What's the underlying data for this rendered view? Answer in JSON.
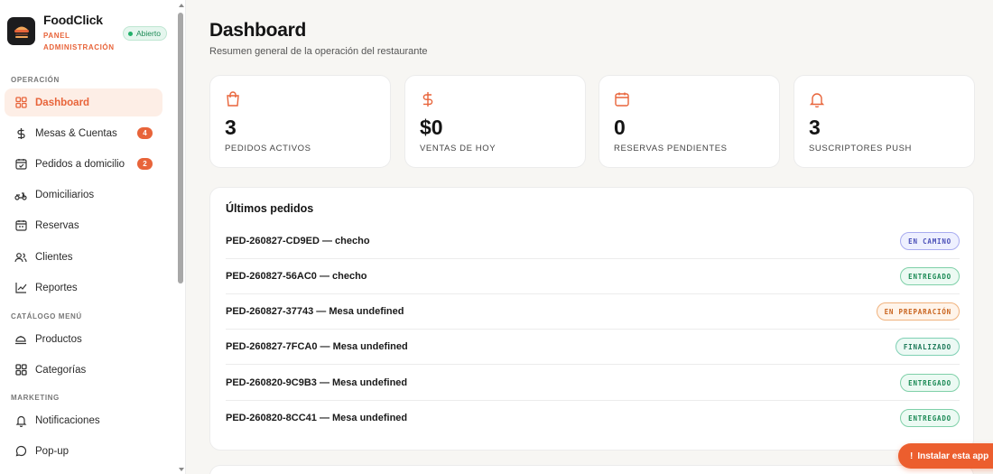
{
  "brand": {
    "name": "FoodClick",
    "subtitle_line1": "PANEL",
    "subtitle_line2": "ADMINISTRACIÓN",
    "status": "Abierto"
  },
  "sidebar": {
    "sections": {
      "operacion": "OPERACIÓN",
      "catalogo": "CATÁLOGO MENÚ",
      "marketing": "MARKETING"
    },
    "items": [
      {
        "label": "Dashboard",
        "icon": "grid-icon",
        "active": true
      },
      {
        "label": "Mesas & Cuentas",
        "icon": "dollar-icon",
        "badge": "4"
      },
      {
        "label": "Pedidos a domicilio",
        "icon": "calendar-check-icon",
        "badge": "2"
      },
      {
        "label": "Domiciliarios",
        "icon": "scooter-icon"
      },
      {
        "label": "Reservas",
        "icon": "calendar-icon"
      },
      {
        "label": "Clientes",
        "icon": "users-icon"
      },
      {
        "label": "Reportes",
        "icon": "chart-line-icon"
      },
      {
        "label": "Productos",
        "icon": "dish-icon"
      },
      {
        "label": "Categorías",
        "icon": "grid-icon"
      },
      {
        "label": "Notificaciones",
        "icon": "bell-icon"
      },
      {
        "label": "Pop-up",
        "icon": "chat-bubble-icon"
      }
    ]
  },
  "header": {
    "title": "Dashboard",
    "subtitle": "Resumen general de la operación del restaurante"
  },
  "stats": [
    {
      "value": "3",
      "label": "PEDIDOS ACTIVOS",
      "icon": "shopping-bag-icon"
    },
    {
      "value": "$0",
      "label": "VENTAS DE HOY",
      "icon": "dollar-icon"
    },
    {
      "value": "0",
      "label": "RESERVAS PENDIENTES",
      "icon": "calendar-icon"
    },
    {
      "value": "3",
      "label": "SUSCRIPTORES PUSH",
      "icon": "bell-icon"
    }
  ],
  "orders": {
    "title": "Últimos pedidos",
    "rows": [
      {
        "text": "PED-260827-CD9ED — checho",
        "status": "EN CAMINO",
        "status_kind": "camino"
      },
      {
        "text": "PED-260827-56AC0 — checho",
        "status": "ENTREGADO",
        "status_kind": "entregado"
      },
      {
        "text": "PED-260827-37743 — Mesa undefined",
        "status": "EN PREPARACIÓN",
        "status_kind": "preparacion"
      },
      {
        "text": "PED-260827-7FCA0 — Mesa undefined",
        "status": "FINALIZADO",
        "status_kind": "finalizado"
      },
      {
        "text": "PED-260820-9C9B3 — Mesa undefined",
        "status": "ENTREGADO",
        "status_kind": "entregado"
      },
      {
        "text": "PED-260820-8CC41 — Mesa undefined",
        "status": "ENTREGADO",
        "status_kind": "entregado"
      }
    ]
  },
  "install_button": {
    "prefix": "!",
    "label": "Instalar esta app"
  },
  "colors": {
    "accent": "#e8643a",
    "camino_text": "#4a4fb8",
    "camino_border": "#a9acf0",
    "camino_bg": "#eef0ff",
    "entregado_text": "#1b8a55",
    "entregado_border": "#7fd0a8",
    "entregado_bg": "#ecfaf3",
    "preparacion_text": "#c9641e",
    "preparacion_border": "#f0b27d",
    "preparacion_bg": "#fff4ea",
    "finalizado_text": "#1f7a5a",
    "finalizado_border": "#7fd0b4",
    "finalizado_bg": "#ecf9f4"
  }
}
